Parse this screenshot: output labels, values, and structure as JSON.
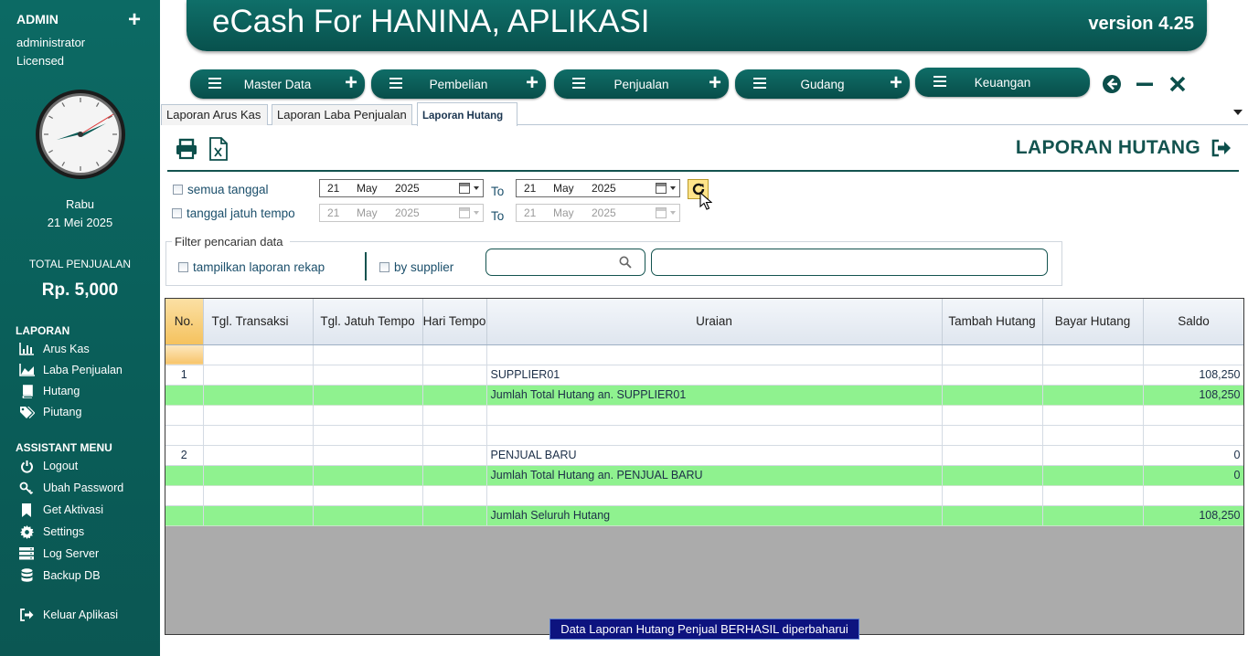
{
  "sidebar": {
    "role": "ADMIN",
    "plus": "+",
    "user": "administrator",
    "license": "Licensed",
    "day": "Rabu",
    "date": "21 Mei 2025",
    "total_label": "TOTAL PENJUALAN",
    "total_value": "Rp. 5,000",
    "laporan_heading": "LAPORAN",
    "laporan_items": [
      {
        "label": "Arus Kas",
        "icon": "bar-chart-icon"
      },
      {
        "label": "Laba Penjualan",
        "icon": "area-chart-icon"
      },
      {
        "label": "Hutang",
        "icon": "book-icon"
      },
      {
        "label": "Piutang",
        "icon": "tags-icon"
      }
    ],
    "assistant_heading": "ASSISTANT MENU",
    "assistant_items": [
      {
        "label": "Logout",
        "icon": "power-icon"
      },
      {
        "label": "Ubah Password",
        "icon": "key-icon"
      },
      {
        "label": "Get Aktivasi",
        "icon": "bookmark-icon"
      },
      {
        "label": "Settings",
        "icon": "gear-icon"
      },
      {
        "label": "Log Server",
        "icon": "server-icon"
      },
      {
        "label": "Backup DB",
        "icon": "database-icon"
      }
    ],
    "exit_label": "Keluar Aplikasi"
  },
  "header": {
    "title": "eCash For HANINA, APLIKASI",
    "version": "version 4.25"
  },
  "menu": [
    {
      "label": "Master Data",
      "has_plus": true
    },
    {
      "label": "Pembelian",
      "has_plus": true
    },
    {
      "label": "Penjualan",
      "has_plus": true
    },
    {
      "label": "Gudang",
      "has_plus": true
    },
    {
      "label": "Keuangan",
      "has_plus": false
    }
  ],
  "tabs": [
    {
      "label": "Laporan Arus Kas",
      "active": false
    },
    {
      "label": "Laporan Laba Penjualan",
      "active": false
    },
    {
      "label": "Laporan Hutang",
      "active": true
    }
  ],
  "report": {
    "title": "LAPORAN HUTANG",
    "semua_tanggal": "semua tanggal",
    "tanggal_jatuh_tempo": "tanggal jatuh tempo",
    "to": "To",
    "date_from": {
      "day": "21",
      "month": "May",
      "year": "2025"
    },
    "date_to": {
      "day": "21",
      "month": "May",
      "year": "2025"
    },
    "due_from": {
      "day": "21",
      "month": "May",
      "year": "2025"
    },
    "due_to": {
      "day": "21",
      "month": "May",
      "year": "2025"
    },
    "filter_legend": "Filter pencarian data",
    "rekap_label": "tampilkan laporan rekap",
    "supplier_label": "by supplier",
    "search_value": "",
    "supplier_value": ""
  },
  "table": {
    "columns": [
      "No.",
      "Tgl. Transaksi",
      "Tgl. Jatuh Tempo",
      "Hari Tempo",
      "Uraian",
      "Tambah Hutang",
      "Bayar Hutang",
      "Saldo"
    ],
    "rows": [
      {
        "no": "",
        "uraian": "",
        "saldo": "",
        "green": false
      },
      {
        "no": "1",
        "uraian": "SUPPLIER01",
        "saldo": "108,250",
        "green": false
      },
      {
        "no": "",
        "uraian": "Jumlah Total Hutang an. SUPPLIER01",
        "saldo": "108,250",
        "green": true
      },
      {
        "no": "",
        "uraian": "",
        "saldo": "",
        "green": false
      },
      {
        "no": "",
        "uraian": "",
        "saldo": "",
        "green": false
      },
      {
        "no": "2",
        "uraian": "PENJUAL BARU",
        "saldo": "0",
        "green": false
      },
      {
        "no": "",
        "uraian": "Jumlah Total Hutang an. PENJUAL BARU",
        "saldo": "0",
        "green": true
      },
      {
        "no": "",
        "uraian": "",
        "saldo": "",
        "green": false
      },
      {
        "no": "",
        "uraian": "Jumlah Seluruh Hutang",
        "saldo": "108,250",
        "green": true
      }
    ]
  },
  "status_message": "Data Laporan Hutang Penjual BERHASIL diperbaharui",
  "colors": {
    "primary": "#0c6a64",
    "accent_green": "#8ff28f",
    "status_bg": "#0d137f"
  }
}
